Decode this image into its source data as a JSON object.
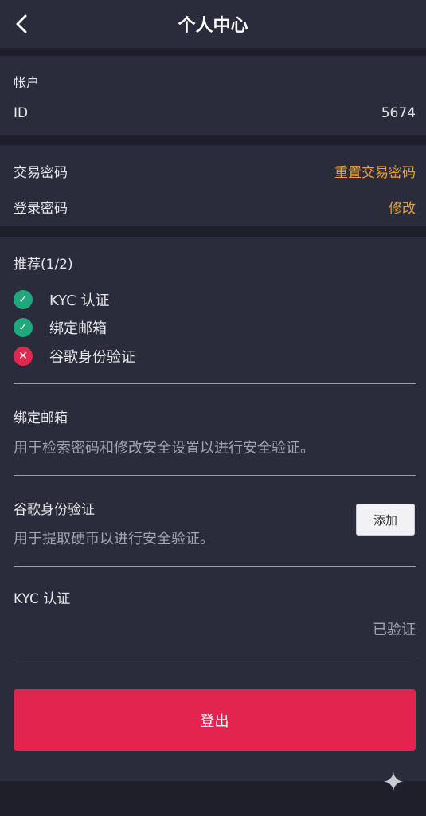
{
  "header": {
    "title": "个人中心",
    "back_icon": "chevron-left-icon"
  },
  "account": {
    "section_label": "帐户",
    "id_label": "ID",
    "id_value": "5674"
  },
  "password": {
    "trade_label": "交易密码",
    "trade_action": "重置交易密码",
    "login_label": "登录密码",
    "login_action": "修改"
  },
  "recommend": {
    "title": "推荐(1/2)",
    "items": [
      {
        "label": "KYC 认证",
        "status": "done"
      },
      {
        "label": "绑定邮箱",
        "status": "done"
      },
      {
        "label": "谷歌身份验证",
        "status": "missing"
      }
    ]
  },
  "email_block": {
    "title": "绑定邮箱",
    "desc": "用于检索密码和修改安全设置以进行安全验证。"
  },
  "google_block": {
    "title": "谷歌身份验证",
    "desc": "用于提取硬币以进行安全验证。",
    "button": "添加"
  },
  "kyc_block": {
    "title": "KYC 认证",
    "status": "已验证"
  },
  "logout": {
    "label": "登出"
  },
  "colors": {
    "accent": "#e8a233",
    "success": "#1ea97c",
    "danger": "#e3244e",
    "panel": "#2b2c3b",
    "background": "#1e1f2a"
  }
}
